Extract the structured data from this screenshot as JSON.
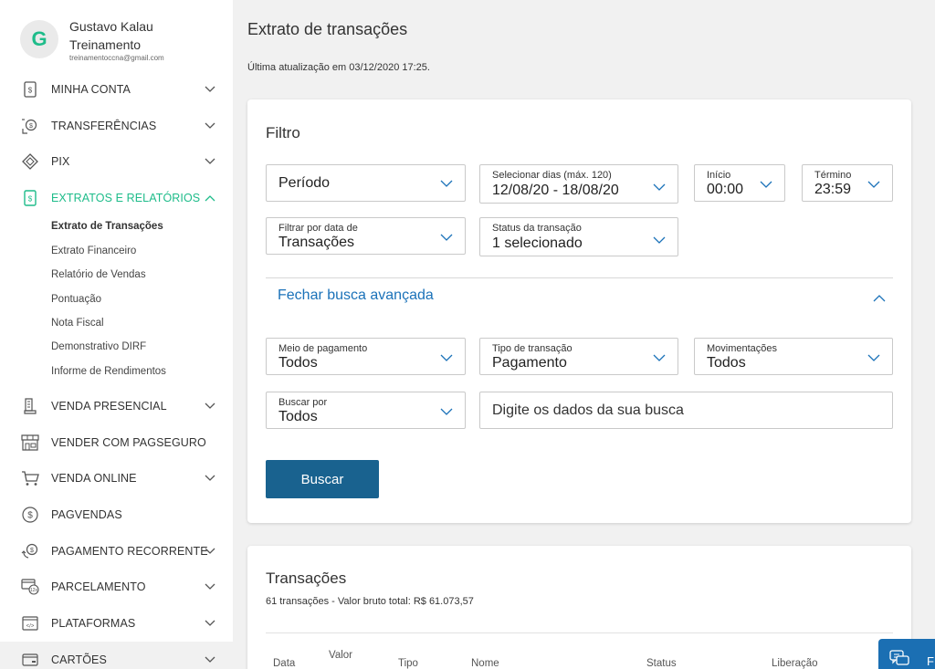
{
  "user": {
    "initial": "G",
    "name": "Gustavo Kalau Treinamento",
    "email": "treinamentoccna@gmail.com"
  },
  "sidebar": {
    "items": [
      {
        "label": "MINHA CONTA",
        "icon": "phone-dollar-icon"
      },
      {
        "label": "TRANSFERÊNCIAS",
        "icon": "transfer-icon"
      },
      {
        "label": "PIX",
        "icon": "pix-icon"
      },
      {
        "label": "EXTRATOS E RELATÓRIOS",
        "icon": "report-icon"
      },
      {
        "label": "VENDA PRESENCIAL",
        "icon": "card-machine-icon"
      },
      {
        "label": "VENDER COM PAGSEGURO",
        "icon": "store-icon"
      },
      {
        "label": "VENDA ONLINE",
        "icon": "cart-icon"
      },
      {
        "label": "PAGVENDAS",
        "icon": "dollar-circle-icon"
      },
      {
        "label": "PAGAMENTO RECORRENTE",
        "icon": "recurring-payment-icon"
      },
      {
        "label": "PARCELAMENTO",
        "icon": "installment-icon"
      },
      {
        "label": "PLATAFORMAS",
        "icon": "code-window-icon"
      },
      {
        "label": "CARTÕES",
        "icon": "card-icon"
      }
    ],
    "sub_items": [
      "Extrato de Transações",
      "Extrato Financeiro",
      "Relatório de Vendas",
      "Pontuação",
      "Nota Fiscal",
      "Demonstrativo DIRF",
      "Informe de Rendimentos"
    ]
  },
  "main": {
    "title": "Extrato de transações",
    "last_update": "Última atualização em 03/12/2020 17:25."
  },
  "filter": {
    "title": "Filtro",
    "periodo": {
      "value": "Período"
    },
    "dias": {
      "label": "Selecionar dias (máx. 120)",
      "value": "12/08/20 - 18/08/20"
    },
    "inicio": {
      "label": "Início",
      "value": "00:00"
    },
    "termino": {
      "label": "Término",
      "value": "23:59"
    },
    "filtrar_data": {
      "label": "Filtrar por data de",
      "value": "Transações"
    },
    "status": {
      "label": "Status da transação",
      "value": "1 selecionado"
    },
    "advanced_toggle": "Fechar busca avançada",
    "meio_pagamento": {
      "label": "Meio de pagamento",
      "value": "Todos"
    },
    "tipo_transacao": {
      "label": "Tipo de transação",
      "value": "Pagamento"
    },
    "movimentacoes": {
      "label": "Movimentações",
      "value": "Todos"
    },
    "buscar_por": {
      "label": "Buscar por",
      "value": "Todos"
    },
    "search_placeholder": "Digite os dados da sua busca",
    "search_button": "Buscar"
  },
  "transactions": {
    "title": "Transações",
    "summary": "61 transações - Valor bruto total: R$ 61.073,57",
    "columns": [
      "Data",
      "Valor",
      "Tipo",
      "Nome",
      "Status",
      "Liberação"
    ]
  },
  "help": {
    "label": "F"
  }
}
